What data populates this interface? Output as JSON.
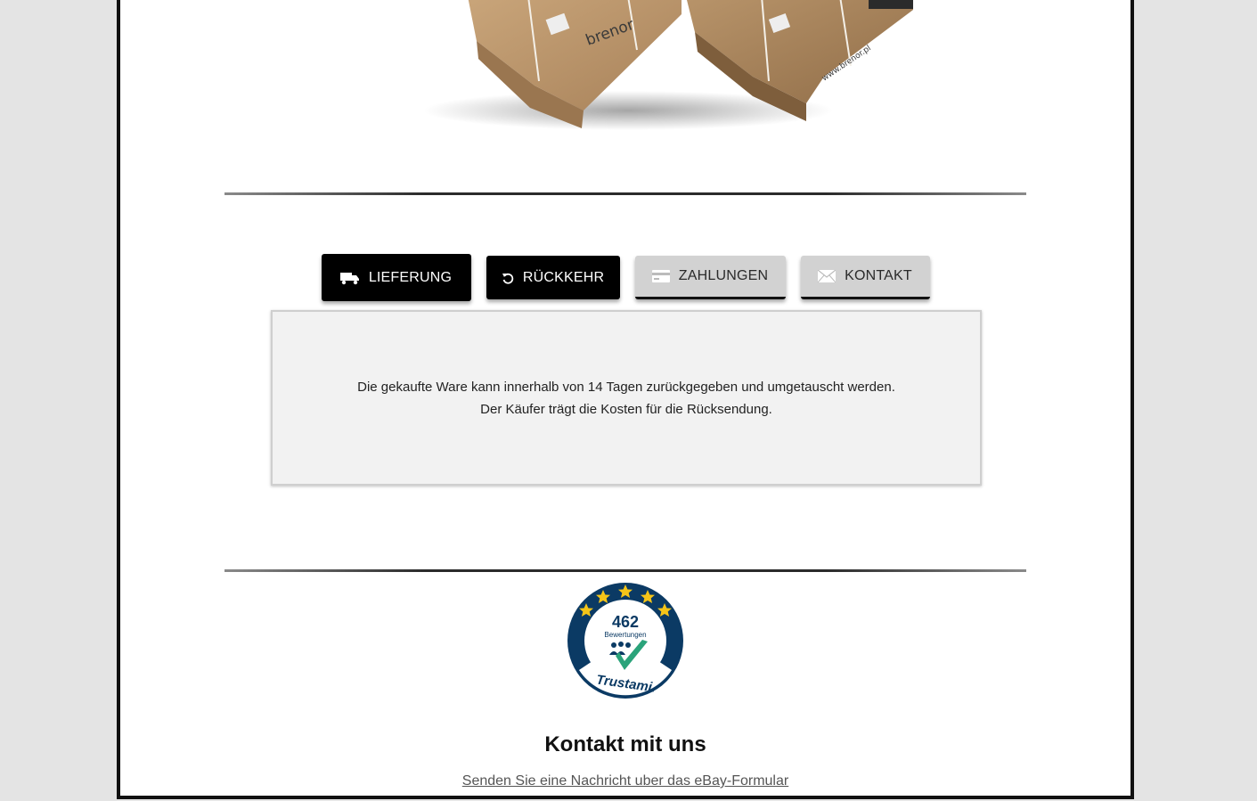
{
  "product_image": {
    "alt": "brenor boxes",
    "brand_text": "brenor",
    "url_text": "www.brenor.pl"
  },
  "tabs": [
    {
      "label": "LIEFERUNG",
      "icon": "truck-icon",
      "style": "dark"
    },
    {
      "label": "RÜCKKEHR",
      "icon": "return-arrow-icon",
      "style": "dark"
    },
    {
      "label": "ZAHLUNGEN",
      "icon": "credit-card-icon",
      "style": "light"
    },
    {
      "label": "KONTAKT",
      "icon": "envelope-icon",
      "style": "light"
    }
  ],
  "return_panel": {
    "line1": "Die gekaufte Ware kann innerhalb von 14 Tagen zurückgegeben und umgetauscht werden.",
    "line2": "Der Käufer trägt die Kosten für die Rücksendung."
  },
  "trust_badge": {
    "count": "462",
    "label": "Bewertungen",
    "brand": "Trustami."
  },
  "contact": {
    "title": "Kontakt mit uns",
    "link_text": "Senden Sie eine Nachricht uber das eBay-Formular"
  },
  "colors": {
    "page_bg": "#e4e4e4",
    "tab_dark": "#000000",
    "tab_light": "#d2d2d2",
    "panel_bg": "#f2f2f2",
    "badge_navy": "#0b3a64",
    "badge_green": "#2aa37a",
    "star_yellow": "#f5c518"
  }
}
